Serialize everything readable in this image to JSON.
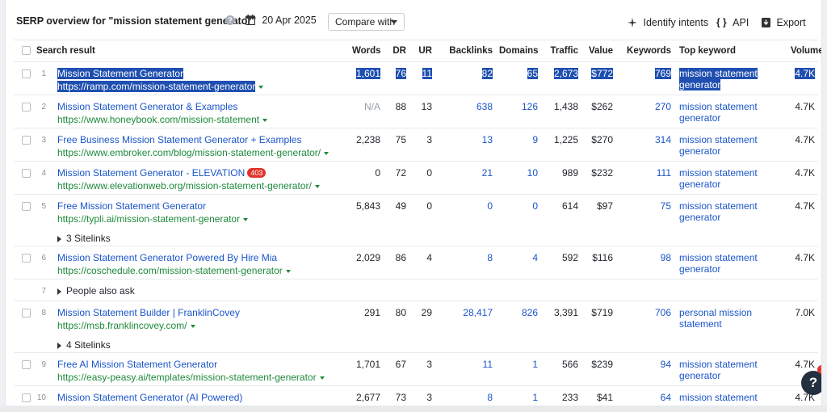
{
  "toolbar": {
    "title": "SERP overview for \"mission statement generator\"",
    "help_icon": "?",
    "date": "20 Apr 2025",
    "compare_label": "Compare with",
    "identify_label": "Identify intents",
    "api_label": "API",
    "api_icon_text": "{ }",
    "export_label": "Export"
  },
  "columns": {
    "search_result": "Search result",
    "words": "Words",
    "dr": "DR",
    "ur": "UR",
    "backlinks": "Backlinks",
    "domains": "Domains",
    "traffic": "Traffic",
    "value": "Value",
    "keywords": "Keywords",
    "top_keyword": "Top keyword",
    "volume": "Volume"
  },
  "rows": [
    {
      "num": "1",
      "title": "Mission Statement Generator",
      "url": "https://ramp.com/mission-statement-generator",
      "words": "1,601",
      "dr": "76",
      "ur": "11",
      "backlinks": "82",
      "domains": "65",
      "traffic": "2,673",
      "value": "$772",
      "keywords": "769",
      "kw1": "mission statement",
      "kw2": "generator",
      "volume": "4.7K"
    },
    {
      "num": "2",
      "title": "Mission Statement Generator & Examples",
      "url": "https://www.honeybook.com/mission-statement",
      "words": "N/A",
      "dr": "88",
      "ur": "13",
      "backlinks": "638",
      "domains": "126",
      "traffic": "1,438",
      "value": "$262",
      "keywords": "270",
      "kw1": "mission statement",
      "kw2": "generator",
      "volume": "4.7K"
    },
    {
      "num": "3",
      "title": "Free Business Mission Statement Generator + Examples",
      "url": "https://www.embroker.com/blog/mission-statement-generator/",
      "words": "2,238",
      "dr": "75",
      "ur": "3",
      "backlinks": "13",
      "domains": "9",
      "traffic": "1,225",
      "value": "$270",
      "keywords": "314",
      "kw1": "mission statement",
      "kw2": "generator",
      "volume": "4.7K"
    },
    {
      "num": "4",
      "title": "Mission Statement Generator - ELEVATION",
      "badge": "403",
      "url": "https://www.elevationweb.org/mission-statement-generator/",
      "words": "0",
      "dr": "72",
      "ur": "0",
      "backlinks": "21",
      "domains": "10",
      "traffic": "989",
      "value": "$232",
      "keywords": "111",
      "kw1": "mission statement",
      "kw2": "generator",
      "volume": "4.7K"
    },
    {
      "num": "5",
      "title": "Free Mission Statement Generator",
      "url": "https://typli.ai/mission-statement-generator",
      "sub": "3 Sitelinks",
      "words": "5,843",
      "dr": "49",
      "ur": "0",
      "backlinks": "0",
      "domains": "0",
      "traffic": "614",
      "value": "$97",
      "keywords": "75",
      "kw1": "mission statement",
      "kw2": "generator",
      "volume": "4.7K"
    },
    {
      "num": "6",
      "title": "Mission Statement Generator Powered By Hire Mia",
      "url": "https://coschedule.com/mission-statement-generator",
      "words": "2,029",
      "dr": "86",
      "ur": "4",
      "backlinks": "8",
      "domains": "4",
      "traffic": "592",
      "value": "$116",
      "keywords": "98",
      "kw1": "mission statement",
      "kw2": "generator",
      "volume": "4.7K"
    },
    {
      "num": "7",
      "paa": "People also ask"
    },
    {
      "num": "8",
      "title": "Mission Statement Builder | FranklinCovey",
      "url": "https://msb.franklincovey.com/",
      "sub": "4 Sitelinks",
      "words": "291",
      "dr": "80",
      "ur": "29",
      "backlinks": "28,417",
      "domains": "826",
      "traffic": "3,391",
      "value": "$719",
      "keywords": "706",
      "kw1": "personal mission statement",
      "kw2": "",
      "volume": "7.0K"
    },
    {
      "num": "9",
      "title": "Free AI Mission Statement Generator",
      "url": "https://easy-peasy.ai/templates/mission-statement-generator",
      "words": "1,701",
      "dr": "67",
      "ur": "3",
      "backlinks": "11",
      "domains": "1",
      "traffic": "566",
      "value": "$239",
      "keywords": "94",
      "kw1": "mission statement",
      "kw2": "generator",
      "volume": "4.7K"
    },
    {
      "num": "10",
      "title": "Mission Statement Generator (AI Powered)",
      "url": "https://www.feedough.com/mission-statement-generator/",
      "words": "2,677",
      "dr": "73",
      "ur": "3",
      "backlinks": "8",
      "domains": "1",
      "traffic": "233",
      "value": "$41",
      "keywords": "64",
      "kw1": "mission statement",
      "kw2": "generator",
      "volume": "4.7K"
    }
  ],
  "help_fab": {
    "label": "?",
    "badge": "1"
  },
  "colors": {
    "link": "#1a55c9",
    "url": "#1e8a3c",
    "selection": "#2d5fc9",
    "badge": "#e0332a"
  }
}
